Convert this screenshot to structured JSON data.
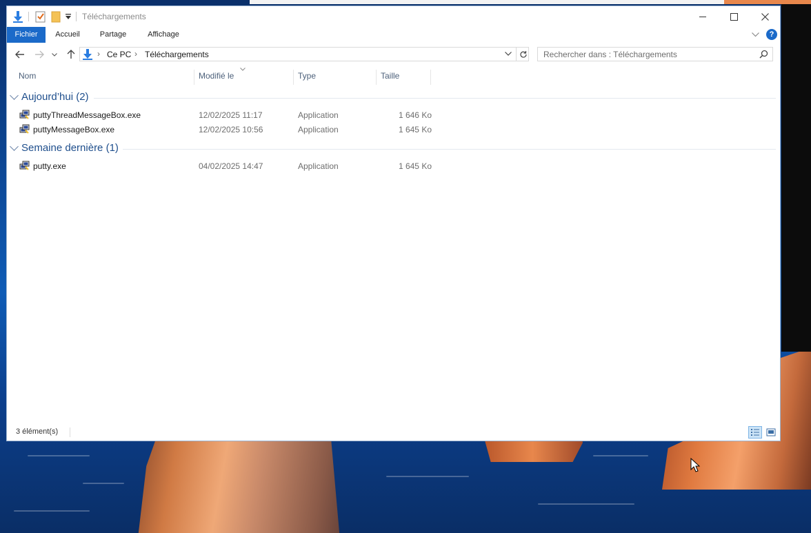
{
  "window": {
    "title": "Téléchargements",
    "quick_access_icons": [
      "download-arrow-icon",
      "properties-icon",
      "new-folder-icon",
      "customize-dropdown-icon"
    ]
  },
  "ribbon": {
    "tabs": [
      {
        "label": "Fichier",
        "active": true
      },
      {
        "label": "Accueil"
      },
      {
        "label": "Partage"
      },
      {
        "label": "Affichage"
      }
    ],
    "help_label": "?"
  },
  "navigation": {
    "breadcrumb": [
      "Ce PC",
      "Téléchargements"
    ],
    "search_placeholder": "Rechercher dans : Téléchargements"
  },
  "columns": [
    "Nom",
    "Modifié le",
    "Type",
    "Taille"
  ],
  "groups": [
    {
      "label": "Aujourd’hui (2)",
      "files": [
        {
          "name": "puttyThreadMessageBox.exe",
          "modified": "12/02/2025 11:17",
          "type": "Application",
          "size": "1 646 Ko"
        },
        {
          "name": "puttyMessageBox.exe",
          "modified": "12/02/2025 10:56",
          "type": "Application",
          "size": "1 645 Ko"
        }
      ]
    },
    {
      "label": "Semaine dernière (1)",
      "files": [
        {
          "name": "putty.exe",
          "modified": "04/02/2025 14:47",
          "type": "Application",
          "size": "1 645 Ko"
        }
      ]
    }
  ],
  "status": {
    "item_count": "3 élément(s)"
  },
  "colors": {
    "accent": "#1b6ac9",
    "group_header": "#1e4e8c",
    "column_header": "#4c607a"
  }
}
